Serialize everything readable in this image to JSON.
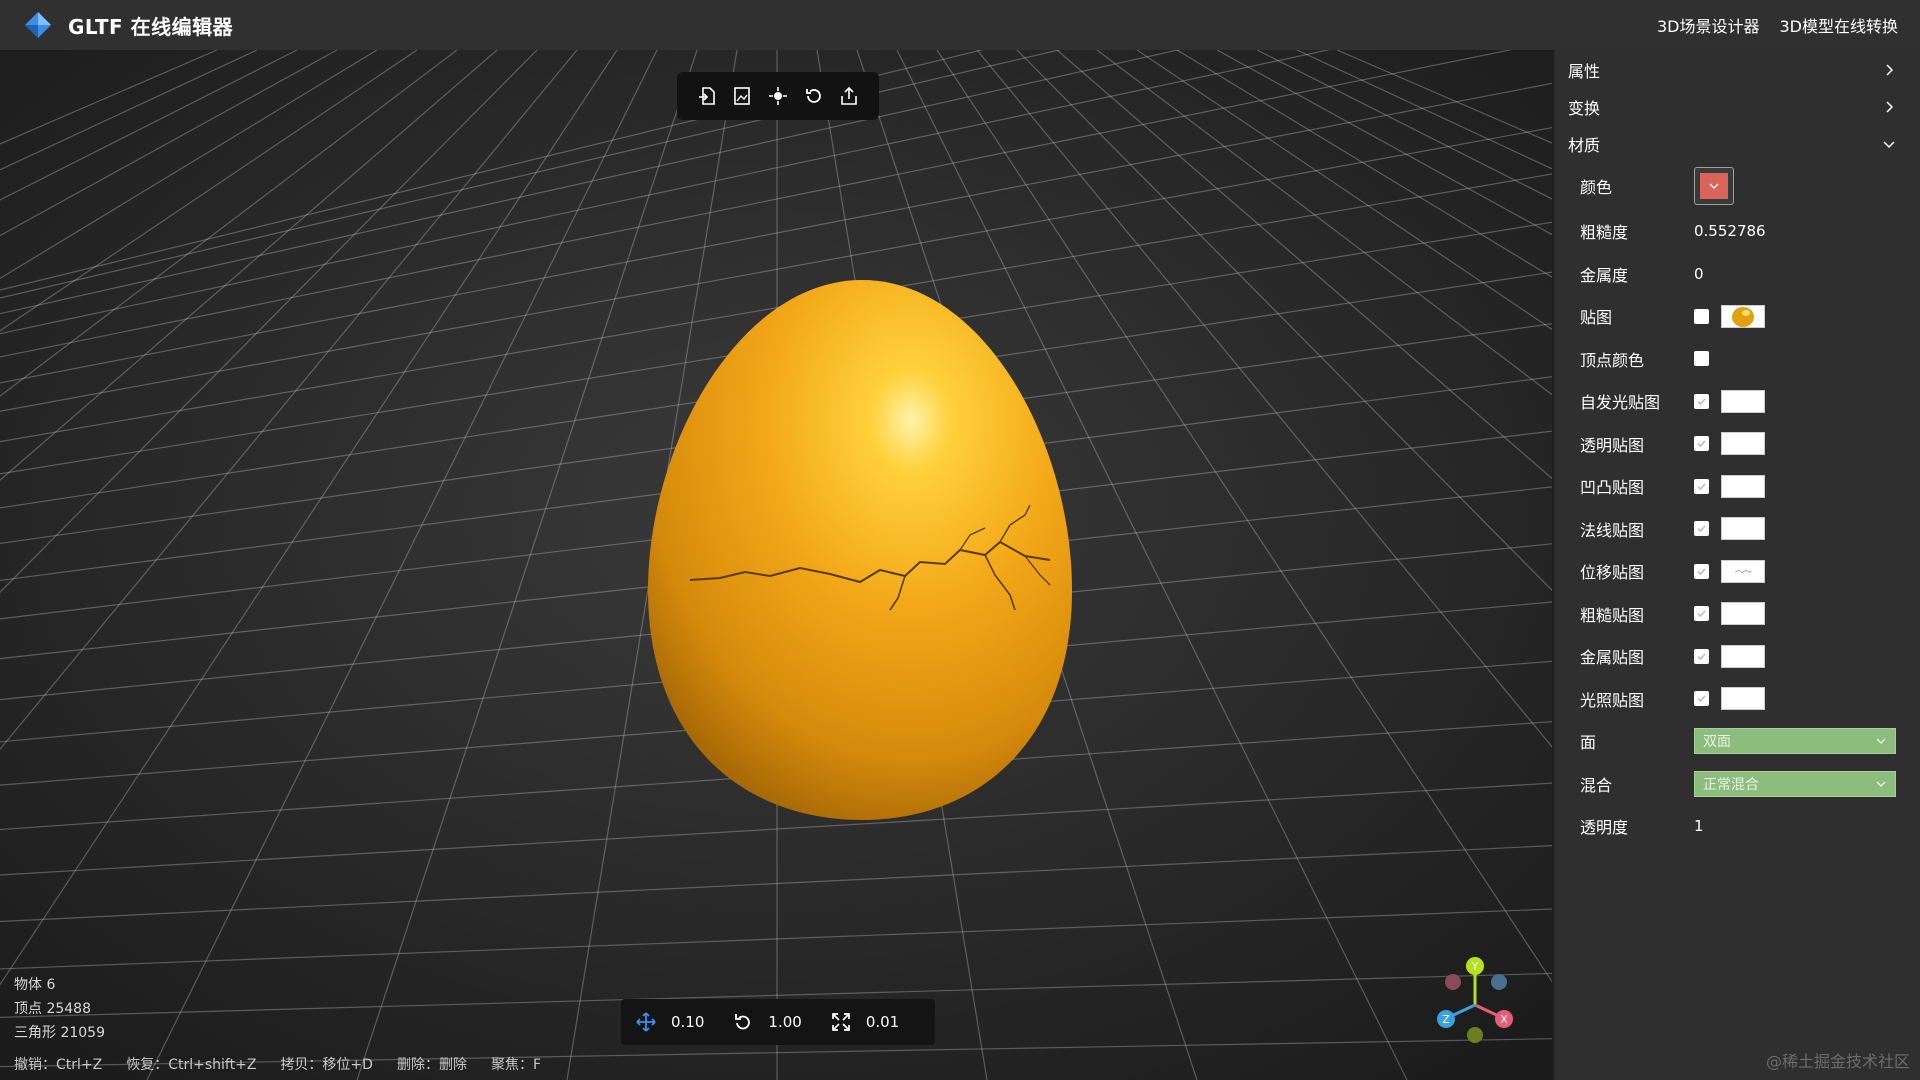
{
  "header": {
    "title": "GLTF 在线编辑器",
    "links": [
      "3D场景设计器",
      "3D模型在线转换"
    ]
  },
  "toolbar": {
    "icons": [
      "import-icon",
      "image-export-icon",
      "focus-icon",
      "reset-icon",
      "export-icon"
    ]
  },
  "stats": {
    "objects": "物体 6",
    "vertices": "顶点 25488",
    "triangles": "三角形 21059"
  },
  "shortcuts": [
    "撤销：Ctrl+Z",
    "恢复：Ctrl+shift+Z",
    "拷贝：移位+D",
    "删除：删除",
    "聚焦：F"
  ],
  "transform_bar": {
    "translate": "0.10",
    "rotate": "1.00",
    "scale": "0.01"
  },
  "gizmo": {
    "x": "X",
    "y": "Y",
    "z": "Z"
  },
  "panel": {
    "sections": {
      "properties": "属性",
      "transform": "变换",
      "material": "材质"
    },
    "material": {
      "color_label": "颜色",
      "color_value": "#d9645a",
      "roughness_label": "粗糙度",
      "roughness_value": "0.552786",
      "metalness_label": "金属度",
      "metalness_value": "0",
      "map_label": "贴图",
      "vertex_colors_label": "顶点颜色",
      "emissive_map_label": "自发光贴图",
      "alpha_map_label": "透明贴图",
      "bump_map_label": "凹凸贴图",
      "normal_map_label": "法线贴图",
      "displacement_map_label": "位移贴图",
      "roughness_map_label": "粗糙贴图",
      "metal_map_label": "金属贴图",
      "light_map_label": "光照贴图",
      "side_label": "面",
      "side_value": "双面",
      "blending_label": "混合",
      "blending_value": "正常混合",
      "opacity_label": "透明度",
      "opacity_value": "1"
    }
  },
  "watermark": "@稀土掘金技术社区",
  "colors": {
    "egg": "#f2a718",
    "select_bg": "#8cbd7c",
    "axis_x": "#e85d75",
    "axis_y": "#b5e21c",
    "axis_z": "#3aa0e0"
  }
}
